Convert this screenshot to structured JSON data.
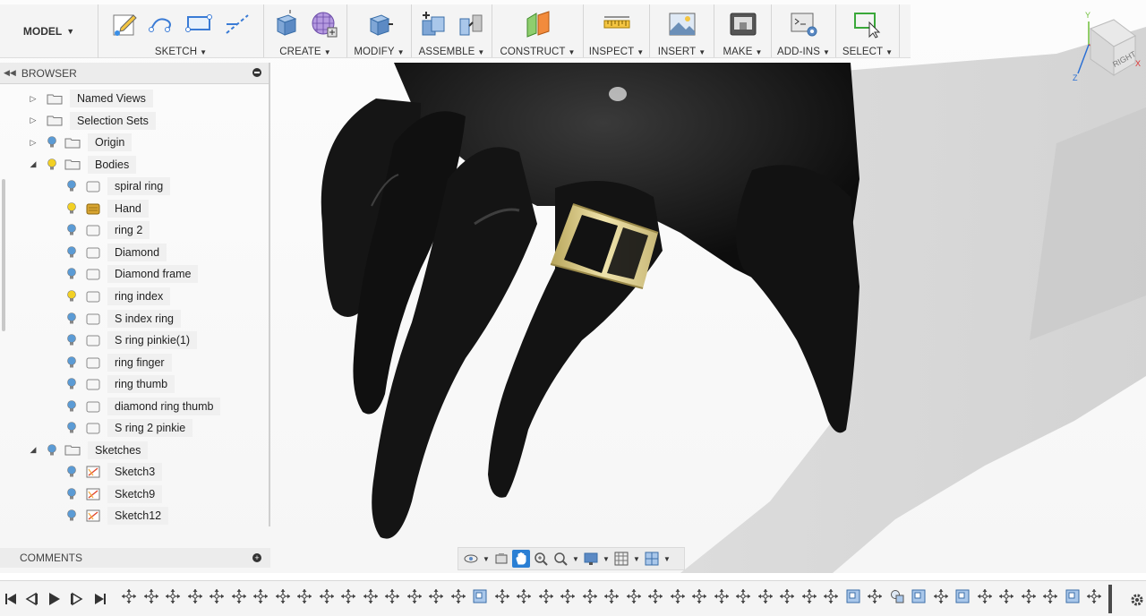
{
  "toolbar": {
    "model_label": "MODEL",
    "groups": [
      {
        "id": "sketch",
        "label": "SKETCH"
      },
      {
        "id": "create",
        "label": "CREATE"
      },
      {
        "id": "modify",
        "label": "MODIFY"
      },
      {
        "id": "assemble",
        "label": "ASSEMBLE"
      },
      {
        "id": "construct",
        "label": "CONSTRUCT"
      },
      {
        "id": "inspect",
        "label": "INSPECT"
      },
      {
        "id": "insert",
        "label": "INSERT"
      },
      {
        "id": "make",
        "label": "MAKE"
      },
      {
        "id": "addins",
        "label": "ADD-INS"
      },
      {
        "id": "select",
        "label": "SELECT"
      }
    ]
  },
  "browser": {
    "title": "BROWSER",
    "items": [
      {
        "label": "Named Views",
        "expand": "collapsed",
        "bulb": false,
        "icon": "folder-icon"
      },
      {
        "label": "Selection Sets",
        "expand": "collapsed",
        "bulb": false,
        "icon": "folder-icon"
      },
      {
        "label": "Origin",
        "expand": "collapsed",
        "bulb": "off",
        "icon": "folder-icon"
      },
      {
        "label": "Bodies",
        "expand": "expanded",
        "bulb": "on",
        "icon": "folder-icon"
      },
      {
        "label": "spiral ring",
        "bulb": "off",
        "icon": "body-icon"
      },
      {
        "label": "Hand",
        "bulb": "on",
        "icon": "body-icon-hand"
      },
      {
        "label": "ring 2",
        "bulb": "off",
        "icon": "body-icon"
      },
      {
        "label": "Diamond",
        "bulb": "off",
        "icon": "body-icon"
      },
      {
        "label": "Diamond frame",
        "bulb": "off",
        "icon": "body-icon"
      },
      {
        "label": "ring index",
        "bulb": "on",
        "icon": "body-icon"
      },
      {
        "label": "S index ring",
        "bulb": "off",
        "icon": "body-icon"
      },
      {
        "label": "S ring pinkie(1)",
        "bulb": "off",
        "icon": "body-icon"
      },
      {
        "label": "ring finger",
        "bulb": "off",
        "icon": "body-icon"
      },
      {
        "label": "ring thumb",
        "bulb": "off",
        "icon": "body-icon"
      },
      {
        "label": "diamond ring thumb",
        "bulb": "off",
        "icon": "body-icon"
      },
      {
        "label": "S ring 2 pinkie",
        "bulb": "off",
        "icon": "body-icon"
      },
      {
        "label": "Sketches",
        "expand": "expanded",
        "bulb": "off",
        "icon": "folder-icon"
      },
      {
        "label": "Sketch3",
        "bulb": "off",
        "icon": "sketch-icon"
      },
      {
        "label": "Sketch9",
        "bulb": "off",
        "icon": "sketch-icon"
      },
      {
        "label": "Sketch12",
        "bulb": "off",
        "icon": "sketch-icon"
      }
    ]
  },
  "comments": {
    "title": "COMMENTS"
  },
  "viewcube": {
    "face_label": "RIGHT",
    "axes": [
      "Y",
      "X",
      "Z"
    ]
  },
  "colors": {
    "toolbar_bg": "#f4f4f4",
    "active_nav": "#2a7fd4",
    "bulb_on": "#f2d024",
    "bulb_off": "#5b9bd5",
    "hand": "#121212",
    "ring_gold": "#d9c98a"
  },
  "timeline": {
    "controls": [
      "skip-to-start",
      "step-back",
      "play",
      "step-forward",
      "skip-to-end"
    ]
  }
}
